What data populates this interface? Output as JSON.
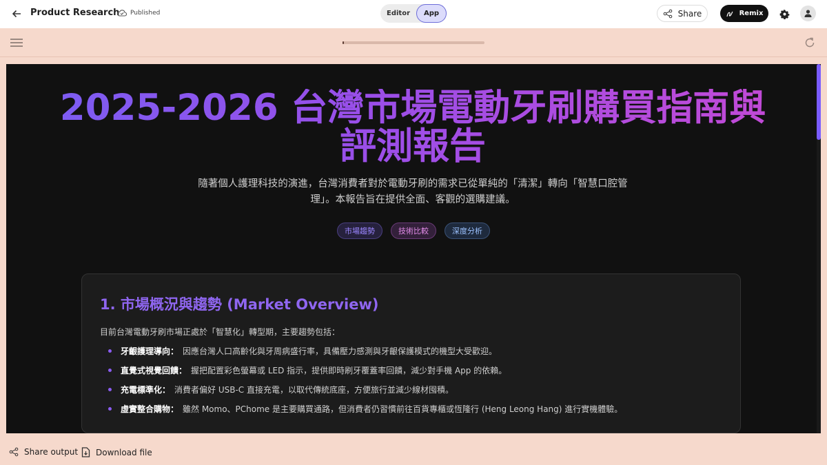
{
  "header": {
    "title": "Product Research",
    "status": "Published",
    "modes": [
      "Editor",
      "App"
    ],
    "active_mode": "App",
    "share_label": "Share",
    "remix_label": "Remix"
  },
  "preview": {
    "progress": 0.01
  },
  "report": {
    "title": "2025-2026 台灣市場電動牙刷購買指南與評測報告",
    "subtitle": "隨著個人護理科技的演進，台灣消費者對於電動牙刷的需求已從單純的「清潔」轉向「智慧口腔管理」。本報告旨在提供全面、客觀的選購建議。",
    "tags": [
      {
        "label": "市場趨勢",
        "color": "#9b86ff",
        "bg": "#26213d",
        "border": "#4a3f80"
      },
      {
        "label": "技術比較",
        "color": "#e08ae6",
        "bg": "#33203a",
        "border": "#6a3a77"
      },
      {
        "label": "深度分析",
        "color": "#9cc2ff",
        "bg": "#1e2a3d",
        "border": "#3a5277"
      }
    ],
    "section1": {
      "title": "1. 市場概況與趨勢 (Market Overview)",
      "intro": "目前台灣電動牙刷市場正處於「智慧化」轉型期，主要趨勢包括：",
      "bullets": [
        {
          "term": "牙齦護理導向：",
          "text": "因應台灣人口高齡化與牙周病盛行率，具備壓力感測與牙齦保護模式的機型大受歡迎。"
        },
        {
          "term": "直覺式視覺回饋：",
          "text": "握把配置彩色螢幕或 LED 指示，提供即時刷牙覆蓋率回饋，減少對手機 App 的依賴。"
        },
        {
          "term": "充電標準化：",
          "text": "消費者偏好 USB-C 直接充電，以取代傳統底座，方便旅行並減少線材囤積。"
        },
        {
          "term": "虛實整合購物：",
          "text": "雖然 Momo、PChome 是主要購買通路，但消費者仍習慣前往百貨專櫃或恆隆行 (Heng Leong Hang) 進行實機體驗。"
        }
      ]
    }
  },
  "footer": {
    "share_output": "Share output",
    "download_file": "Download file"
  }
}
